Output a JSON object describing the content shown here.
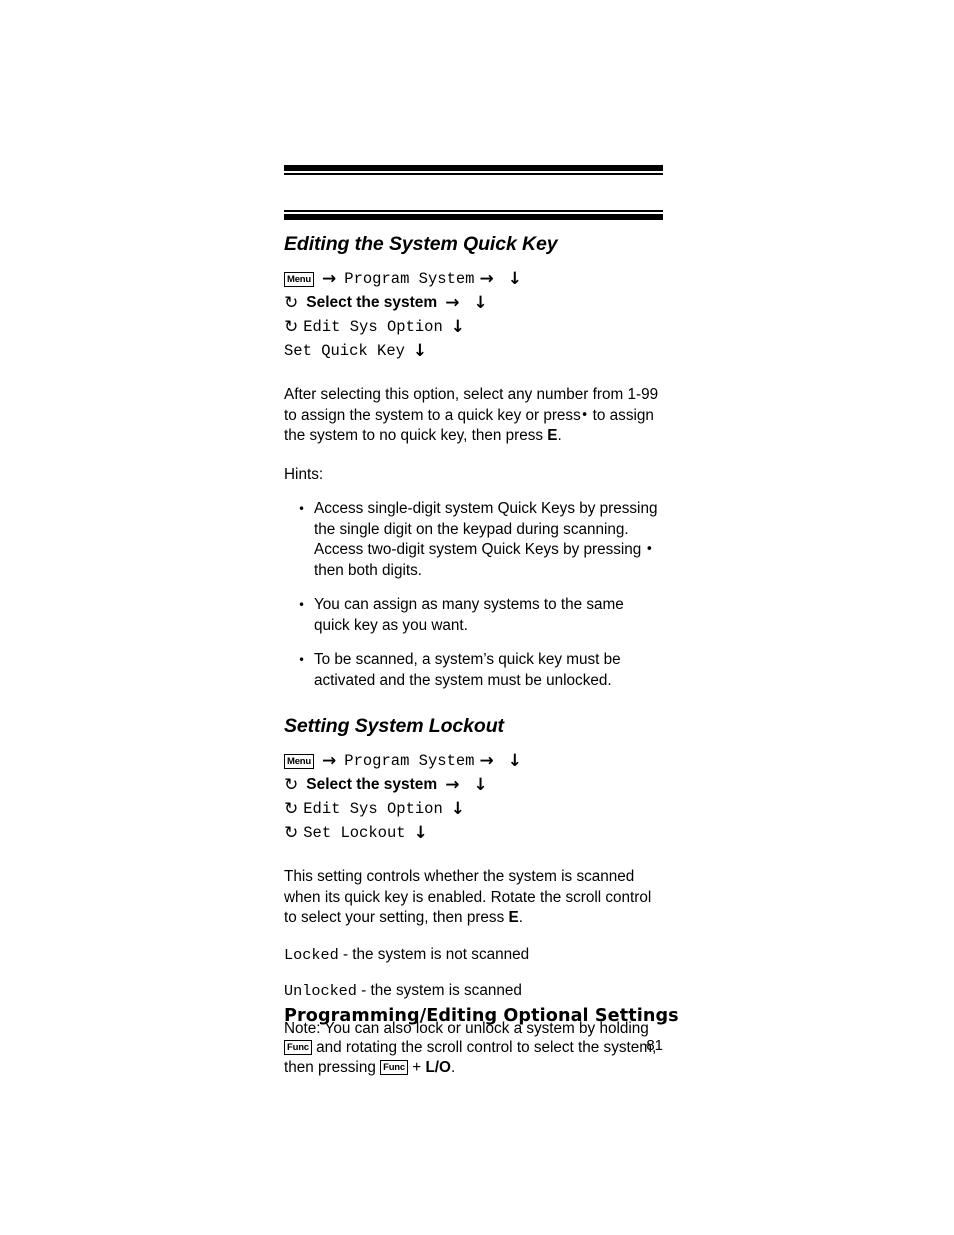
{
  "page": {
    "number": "81",
    "footer_title": "Programming/Editing Optional Settings"
  },
  "sections": [
    {
      "heading": "Editing the System Quick Key",
      "path": [
        {
          "badge": "Menu",
          "arrow_after_badge": "→",
          "label": "Program System",
          "style": "mono",
          "arrow_right": "→",
          "arrow_down": "↓"
        },
        {
          "rotate": "↺",
          "label": "Select the system",
          "style": "sans-bold",
          "arrow_right": "→",
          "arrow_down": "↓"
        },
        {
          "rotate": "↺",
          "label": "Edit Sys Option",
          "style": "mono",
          "arrow_down": "↓"
        },
        {
          "label": "Set Quick Key",
          "style": "mono",
          "arrow_down": "↓"
        }
      ],
      "body": {
        "para1_a": "After selecting this option, select any number from 1-99 to assign the system to a quick key or press",
        "para1_dot": "•",
        "para1_b": "to assign the system to no quick key, then press",
        "para1_key": "E",
        "para1_end": ".",
        "hints_label": "Hints:",
        "hints": [
          {
            "text_a": "Access single-digit system Quick Keys by pressing the single digit on the keypad during scanning. Access two-digit system Quick Keys by pressing",
            "dot": "•",
            "text_b": "then both digits."
          },
          {
            "text_a": "You can assign as many systems to the same quick key as you want."
          },
          {
            "text_a": "To be scanned, a system’s quick key must be activated and the system must be unlocked."
          }
        ]
      }
    },
    {
      "heading": "Setting System Lockout",
      "path": [
        {
          "badge": "Menu",
          "arrow_after_badge": "→",
          "label": "Program System",
          "style": "mono",
          "arrow_right": "→",
          "arrow_down": "↓"
        },
        {
          "rotate": "↺",
          "label": "Select the system",
          "style": "sans-bold",
          "arrow_right": "→",
          "arrow_down": "↓"
        },
        {
          "rotate": "↺",
          "label": "Edit Sys Option",
          "style": "mono",
          "arrow_down": "↓"
        },
        {
          "rotate": "↺",
          "label": "Set Lockout",
          "style": "mono",
          "arrow_down": "↓"
        }
      ],
      "body": {
        "para1_a": "This setting controls whether the system is scanned when its quick key is enabled. Rotate the scroll control to select your setting, then press",
        "para1_key": "E",
        "para1_end": ".",
        "definitions": [
          {
            "term": "Locked",
            "desc": "- the system is not scanned"
          },
          {
            "term": "Unlocked",
            "desc": "- the system is scanned"
          }
        ],
        "note": {
          "line1": "Note: You can also lock or unlock a system by holding",
          "badge1": "Func",
          "line2": "and rotating the scroll control to select the system, then pressing",
          "badge2": "Func",
          "plus": "+",
          "key": "L/O",
          "end": "."
        }
      }
    }
  ]
}
